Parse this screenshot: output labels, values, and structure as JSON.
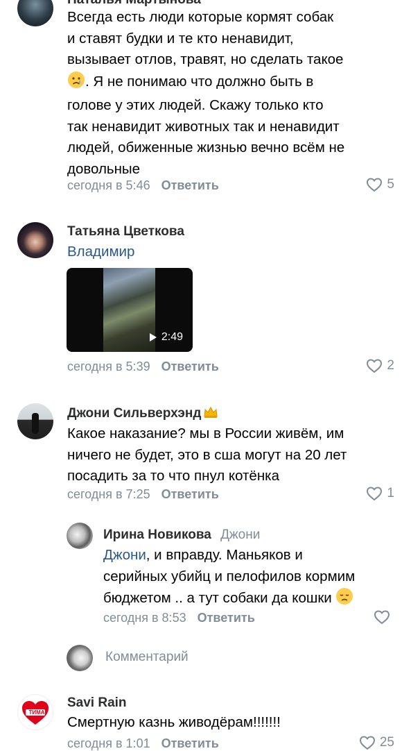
{
  "comments": [
    {
      "author": "Наталья Мартынова",
      "text_lines": [
        "Всегда есть люди которые кормят собак",
        "и ставят будки и те кто ненавидит,",
        "вызывает отлов, травят, но сделать такое",
        ". Я не понимаю что должно быть в",
        "голове у этих людей. Скажу только кто",
        "так ненавидит животных так и ненавидит",
        "людей,  обиженные жизнью  вечно всём не",
        "довольные"
      ],
      "inline_emoji": "crying-face-emoji",
      "time": "сегодня в 5:46",
      "reply_label": "Ответить",
      "likes": "5"
    },
    {
      "author": "Татьяна Цветкова",
      "mention": "Владимир",
      "video_duration": "2:49",
      "time": "сегодня в 5:39",
      "reply_label": "Ответить",
      "likes": "2"
    },
    {
      "author": "Джони Сильверхэнд",
      "author_badge": "crown-emoji",
      "text_lines": [
        "Какое наказание? мы в России живём,  им",
        "ничего не будет, это  в сша могут на 20 лет",
        "посадить за то что пнул котёнка"
      ],
      "time": "сегодня в 7:25",
      "reply_label": "Ответить",
      "likes": "1",
      "reply": {
        "author": "Ирина Новикова",
        "reply_to": "Джони",
        "mention": "Джони",
        "text_lines": [
          ", и вправду. Маньяков и",
          "серийных убийц и пелофилов кормим",
          "бюджетом .. а тут собаки да кошки"
        ],
        "inline_emoji": "disappointed-face-emoji",
        "time": "сегодня в 8:53",
        "reply_label": "Ответить",
        "likes": ""
      }
    },
    {
      "author": "Savi Rain",
      "avatar_text": "TИMA",
      "text_lines": [
        "Смертную казнь живодёрам!!!!!!!"
      ],
      "time": "сегодня в 1:01",
      "reply_label": "Ответить",
      "likes": "25"
    }
  ],
  "composer": {
    "placeholder": "Комментарий"
  },
  "colors": {
    "link": "#2a5885",
    "meta": "#818c99",
    "author": "#2c2d2e"
  },
  "icons": {
    "like": "heart-outline-icon",
    "play": "play-icon"
  }
}
